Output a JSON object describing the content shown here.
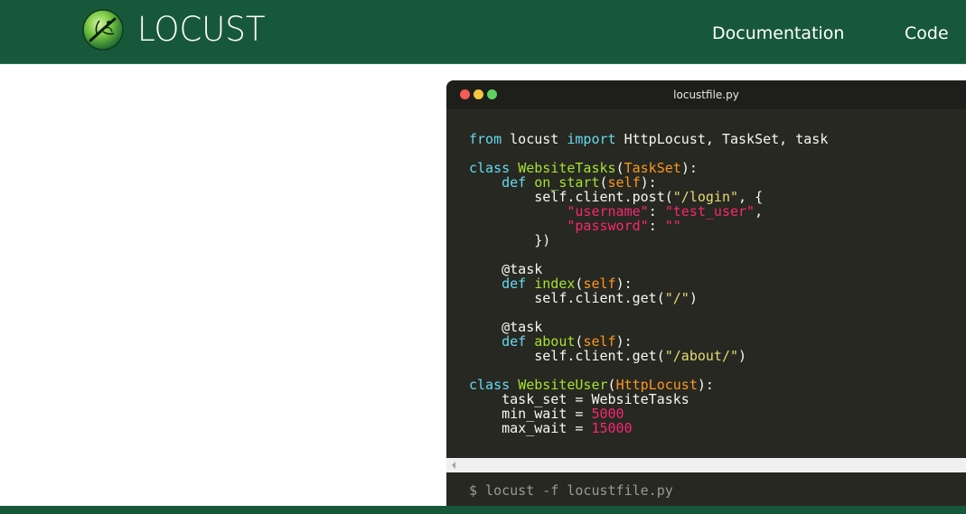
{
  "header": {
    "logo_text": "LOCUST",
    "nav": [
      {
        "label": "Documentation"
      },
      {
        "label": "Code"
      }
    ]
  },
  "code_window": {
    "filename": "locustfile.py",
    "code": {
      "l1_from": "from",
      "l1_mod": " locust ",
      "l1_import": "import",
      "l1_names": " HttpLocust, TaskSet, task",
      "c1_kw": "class",
      "c1_name": "WebsiteTasks",
      "c1_base": "TaskSet",
      "d1_kw": "def",
      "d1_name": "on_start",
      "d1_self": "self",
      "post_call": "self.client.post(",
      "post_url": "\"/login\"",
      "post_tail": ", {",
      "username_key": "\"username\"",
      "username_val": "\"test_user\"",
      "password_key": "\"password\"",
      "password_val": "\"\"",
      "close_dict": "})",
      "deco1": "@task",
      "d2_kw": "def",
      "d2_name": "index",
      "d2_self": "self",
      "get1_call": "self.client.get(",
      "get1_url": "\"/\"",
      "deco2": "@task",
      "d3_kw": "def",
      "d3_name": "about",
      "d3_self": "self",
      "get2_call": "self.client.get(",
      "get2_url": "\"/about/\"",
      "c2_kw": "class",
      "c2_name": "WebsiteUser",
      "c2_base": "HttpLocust",
      "taskset_line": "task_set = WebsiteTasks",
      "min_wait_name": "min_wait = ",
      "min_wait_val": "5000",
      "max_wait_name": "max_wait = ",
      "max_wait_val": "15000"
    },
    "terminal_command": "$ locust -f locustfile.py"
  },
  "colors": {
    "header_green": "#17583a",
    "editor_bg": "#272822",
    "keyword": "#66d9ef",
    "class_name": "#a6e22e",
    "base_class": "#fd971f",
    "string": "#e6db74",
    "number": "#f92672"
  },
  "icons": {
    "logo": "locust-logo-icon",
    "window_controls": [
      "close-dot",
      "minimize-dot",
      "maximize-dot"
    ],
    "scroll": "scroll-left-arrow-icon"
  }
}
